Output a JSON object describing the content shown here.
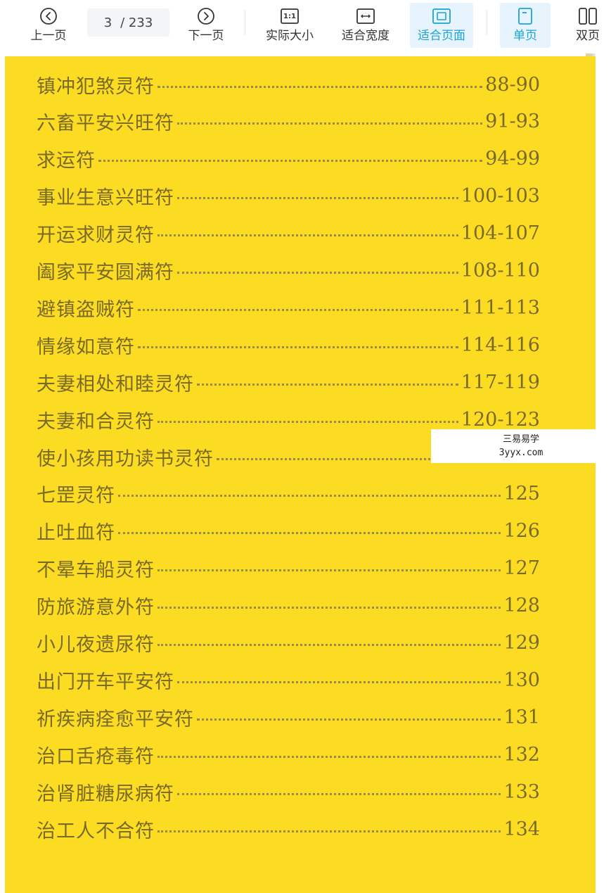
{
  "toolbar": {
    "prev_label": "上一页",
    "next_label": "下一页",
    "current_page": "3",
    "total_pages": "/ 233",
    "actual_size_label": "实际大小",
    "actual_size_icon_text": "1:1",
    "fit_width_label": "适合宽度",
    "fit_page_label": "适合页面",
    "single_page_label": "单页",
    "double_page_label": "双页",
    "accent_color": "#1aa3d9"
  },
  "toc": {
    "entries": [
      {
        "title": "镇冲犯煞灵符",
        "pages": "88-90"
      },
      {
        "title": "六畜平安兴旺符",
        "pages": "91-93"
      },
      {
        "title": "求运符",
        "pages": "94-99"
      },
      {
        "title": "事业生意兴旺符",
        "pages": "100-103"
      },
      {
        "title": "开运求财灵符",
        "pages": "104-107"
      },
      {
        "title": "阖家平安圆满符",
        "pages": "108-110"
      },
      {
        "title": "避镇盗贼符",
        "pages": "111-113"
      },
      {
        "title": "情缘如意符",
        "pages": "114-116"
      },
      {
        "title": "夫妻相处和睦灵符",
        "pages": "117-119"
      },
      {
        "title": "夫妻和合灵符",
        "pages": "120-123"
      },
      {
        "title": "使小孩用功读书灵符",
        "pages": ""
      },
      {
        "title": "七罡灵符",
        "pages": "125"
      },
      {
        "title": "止吐血符",
        "pages": "126"
      },
      {
        "title": "不晕车船灵符",
        "pages": "127"
      },
      {
        "title": "防旅游意外符",
        "pages": "128"
      },
      {
        "title": "小儿夜遗尿符",
        "pages": "129"
      },
      {
        "title": "出门开车平安符",
        "pages": "130"
      },
      {
        "title": "祈疾病痊愈平安符",
        "pages": "131"
      },
      {
        "title": "治口舌疮毒符",
        "pages": "132"
      },
      {
        "title": "治肾脏糖尿病符",
        "pages": "133"
      },
      {
        "title": "治工人不合符",
        "pages": "134"
      }
    ]
  },
  "watermark": {
    "line1": "三易易学",
    "line2": "3yyx.com"
  },
  "page_color": "#fbdc22"
}
